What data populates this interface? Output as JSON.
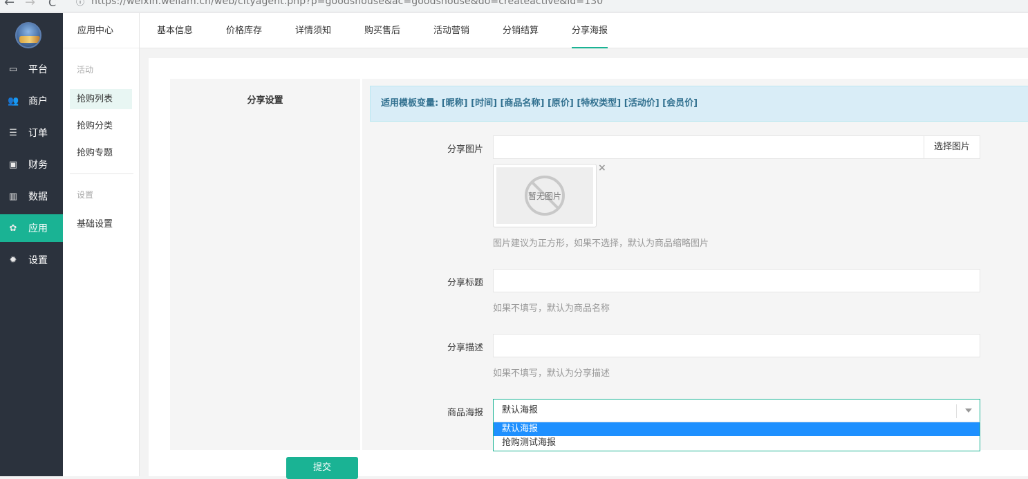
{
  "browser": {
    "url": "https://weixin.weilam.cn/web/cityagent.php?p=goodshouse&ac=goodshouse&do=createactive&id=130",
    "back_glyph": "←",
    "forward_glyph": "→",
    "reload_glyph": "C",
    "info_glyph": "ⓘ"
  },
  "sidebar": {
    "items": [
      {
        "label": "平台",
        "icon": "monitor-icon",
        "glyph": "▭"
      },
      {
        "label": "商户",
        "icon": "users-icon",
        "glyph": "👥"
      },
      {
        "label": "订单",
        "icon": "list-icon",
        "glyph": "☰"
      },
      {
        "label": "财务",
        "icon": "money-icon",
        "glyph": "▣"
      },
      {
        "label": "数据",
        "icon": "bar-chart-icon",
        "glyph": "▥"
      },
      {
        "label": "应用",
        "icon": "cubes-icon",
        "glyph": "✿"
      },
      {
        "label": "设置",
        "icon": "gear-icon",
        "glyph": "✹"
      }
    ],
    "active": "应用"
  },
  "subnav": {
    "header": "应用中心",
    "group1_title": "活动",
    "group1_items": [
      "抢购列表",
      "抢购分类",
      "抢购专题"
    ],
    "group2_title": "设置",
    "group2_items": [
      "基础设置"
    ],
    "active": "抢购列表"
  },
  "tabs": {
    "items": [
      "基本信息",
      "价格库存",
      "详情须知",
      "购买售后",
      "活动营销",
      "分销结算",
      "分享海报"
    ],
    "active": "分享海报"
  },
  "form": {
    "section_title": "分享设置",
    "alert": "适用模板变量: [昵称] [时间] [商品名称] [原价] [特权类型] [活动价] [会员价]",
    "share_image": {
      "label": "分享图片",
      "value": "",
      "button": "选择图片",
      "no_image_text": "暂无图片",
      "remove_glyph": "×",
      "hint": "图片建议为正方形，如果不选择，默认为商品缩略图片"
    },
    "share_title": {
      "label": "分享标题",
      "value": "",
      "hint": "如果不填写，默认为商品名称"
    },
    "share_desc": {
      "label": "分享描述",
      "value": "",
      "hint": "如果不填写，默认为分享描述"
    },
    "poster": {
      "label": "商品海报",
      "selected": "默认海报",
      "options": [
        "默认海报",
        "抢购测试海报"
      ]
    },
    "submit": "提交"
  },
  "colors": {
    "sidebar_bg": "#2b323d",
    "accent": "#1ab394",
    "alert_bg": "#d9edf7",
    "alert_text": "#31708f",
    "option_highlight": "#1e90ff"
  }
}
